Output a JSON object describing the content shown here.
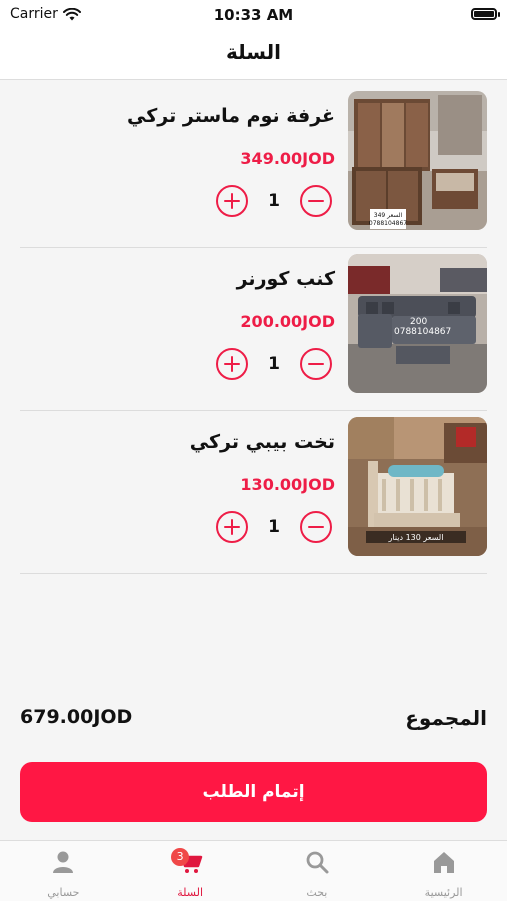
{
  "status_bar": {
    "carrier": "Carrier",
    "time": "10:33 AM"
  },
  "header": {
    "title": "السلة"
  },
  "cart": {
    "items": [
      {
        "name": "غرفة نوم ماستر تركي",
        "price": "349.00JOD",
        "quantity": "1",
        "image": "bedroom-set-photo"
      },
      {
        "name": "كنب كورنر",
        "price": "200.00JOD",
        "quantity": "1",
        "image": "corner-sofa-photo"
      },
      {
        "name": "تخت بيبي تركي",
        "price": "130.00JOD",
        "quantity": "1",
        "image": "baby-crib-photo"
      }
    ]
  },
  "summary": {
    "total_label": "المجموع",
    "total_value": "679.00JOD"
  },
  "checkout": {
    "label": "إتمام الطلب"
  },
  "tab_bar": {
    "items": [
      {
        "label": "الرئيسية",
        "icon": "home-icon"
      },
      {
        "label": "بحث",
        "icon": "search-icon"
      },
      {
        "label": "السلة",
        "icon": "cart-icon",
        "badge": "3",
        "active": true
      },
      {
        "label": "حسابي",
        "icon": "person-icon"
      }
    ]
  },
  "colors": {
    "accent": "#ff1744",
    "price": "#ee1d47",
    "inactive_tab": "#999999"
  }
}
